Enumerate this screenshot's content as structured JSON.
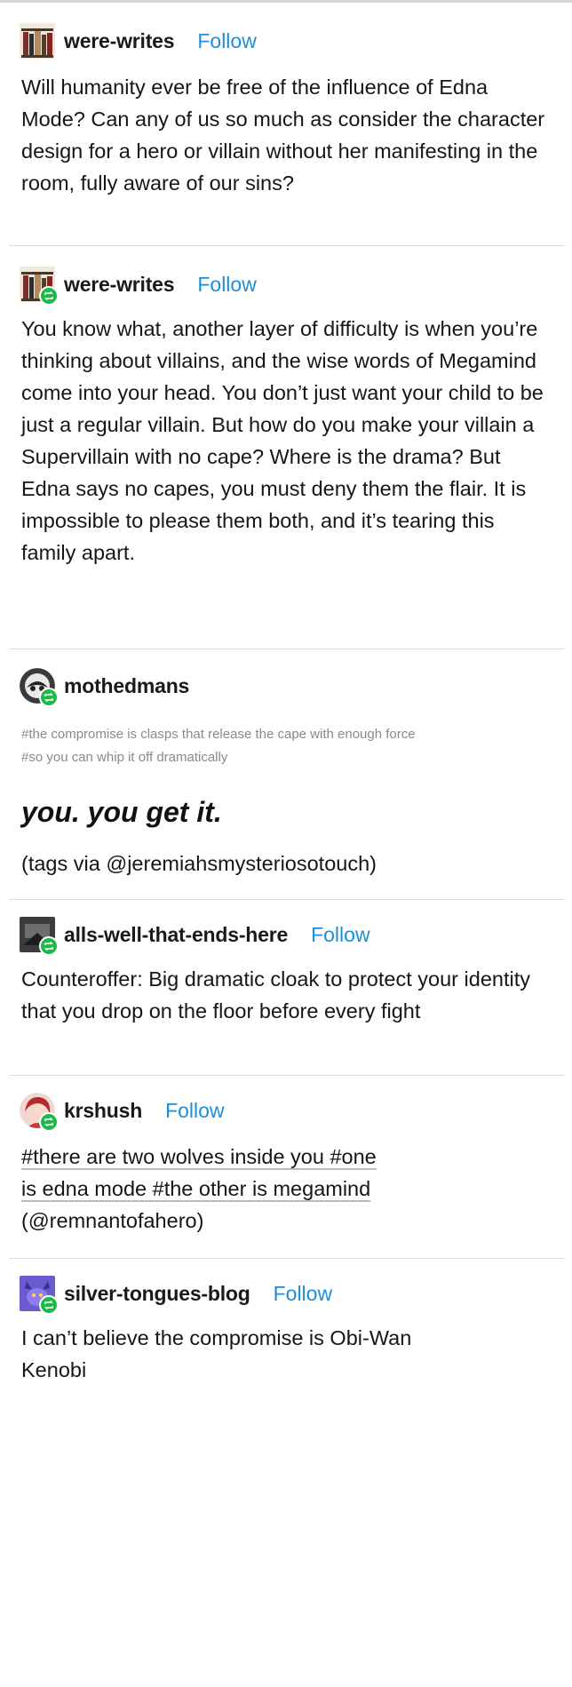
{
  "posts": [
    {
      "username": "were-writes",
      "follow_label": "Follow",
      "text": "Will humanity ever be free of the influence of Edna Mode? Can any of us so much as consider the character design for a hero or villain without her manifesting in the room, fully aware of our sins?"
    },
    {
      "username": "were-writes",
      "follow_label": "Follow",
      "text": "You know what, another layer of difficulty is when you’re thinking about villains, and the wise words of Megamind come into your head. You don’t just want your child to be just a regular villain. But how do you make your villain a Supervillain with no cape? Where is the drama? But Edna says no capes, you must deny them the flair. It is impossible to please them both, and it’s tearing this family apart."
    },
    {
      "username": "mothedmans",
      "tags_line1": "#the compromise is clasps that release the cape with enough force",
      "tags_line2": "#so you can whip it off dramatically",
      "big_text": "you. you get it.",
      "tags_via": "(tags via @jeremiahsmysteriosotouch)"
    },
    {
      "username": "alls-well-that-ends-here",
      "follow_label": "Follow",
      "text": "Counteroffer: Big dramatic cloak to protect your identity that you drop on the floor before every fight"
    },
    {
      "username": "krshush",
      "follow_label": "Follow",
      "line1": "#there are two wolves inside you #one",
      "line2": "is edna mode #the other is megamind",
      "line3": "(@remnantofahero)"
    },
    {
      "username": "silver-tongues-blog",
      "follow_label": "Follow",
      "text": "I can’t believe the compromise is Obi-Wan Kenobi"
    }
  ],
  "colors": {
    "follow": "#1c8fd8",
    "reblog_badge": "#1fb84b",
    "tags": "#8a8a8a"
  },
  "icons": [
    "bookshelf-avatar-icon",
    "reblog-icon",
    "moth-avatar-icon",
    "blog-avatar-icon",
    "person-avatar-icon",
    "purple-creature-avatar-icon"
  ]
}
